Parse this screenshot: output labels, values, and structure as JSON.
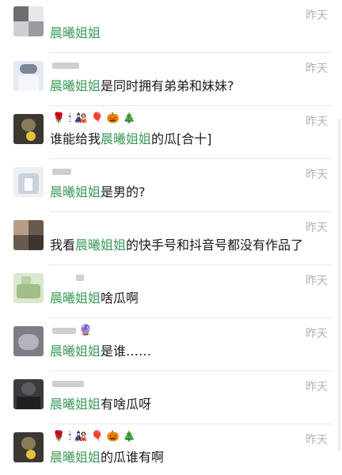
{
  "comments": [
    {
      "time": "昨天",
      "pre": "",
      "mention": "晨曦姐姐",
      "post": "",
      "emoji": ""
    },
    {
      "time": "昨天",
      "pre": "",
      "mention": "晨曦姐姐",
      "post": "是同时拥有弟弟和妹妹?",
      "emoji": ""
    },
    {
      "time": "昨天",
      "pre": "谁能给我",
      "mention": "晨曦姐姐",
      "post": "的瓜[合十]",
      "emoji": "🌹 🕯 🎎 🎈 🎃 🎄"
    },
    {
      "time": "昨天",
      "pre": "",
      "mention": "晨曦姐姐",
      "post": "是男的?",
      "emoji": ""
    },
    {
      "time": "昨天",
      "pre": "我看",
      "mention": "晨曦姐姐",
      "post": "的快手号和抖音号都没有作品了",
      "emoji": ""
    },
    {
      "time": "昨天",
      "pre": "",
      "mention": "晨曦姐姐",
      "post": "啥瓜啊",
      "emoji": ""
    },
    {
      "time": "昨天",
      "pre": "",
      "mention": "晨曦姐姐",
      "post": "是谁……",
      "emoji": "🔮"
    },
    {
      "time": "昨天",
      "pre": "",
      "mention": "晨曦姐姐",
      "post": "有啥瓜呀",
      "emoji": ""
    },
    {
      "time": "昨天",
      "pre": "",
      "mention": "晨曦姐姐",
      "post": "的瓜谁有啊",
      "emoji": "🌹 🕯 🎎 🎈 🎃 🎄"
    }
  ]
}
